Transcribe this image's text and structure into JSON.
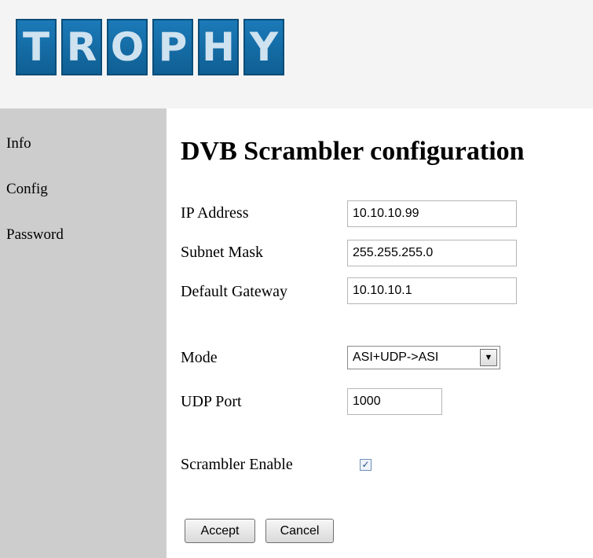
{
  "logo": {
    "letters": [
      "T",
      "R",
      "O",
      "P",
      "H",
      "Y"
    ]
  },
  "sidebar": {
    "items": [
      {
        "label": "Info"
      },
      {
        "label": "Config"
      },
      {
        "label": "Password"
      }
    ]
  },
  "main": {
    "title": "DVB Scrambler configuration",
    "fields": {
      "ip_address": {
        "label": "IP Address",
        "value": "10.10.10.99"
      },
      "subnet_mask": {
        "label": "Subnet Mask",
        "value": "255.255.255.0"
      },
      "default_gateway": {
        "label": "Default Gateway",
        "value": "10.10.10.1"
      },
      "mode": {
        "label": "Mode",
        "value": "ASI+UDP->ASI"
      },
      "udp_port": {
        "label": "UDP Port",
        "value": "1000"
      },
      "scrambler_enable": {
        "label": "Scrambler Enable",
        "checked": true,
        "check_glyph": "✓"
      }
    },
    "buttons": {
      "accept": "Accept",
      "cancel": "Cancel"
    }
  },
  "colors": {
    "sidebar_bg": "#cdcdcd",
    "header_bg": "#f4f4f4",
    "logo_tile": "#1b7ab8"
  }
}
